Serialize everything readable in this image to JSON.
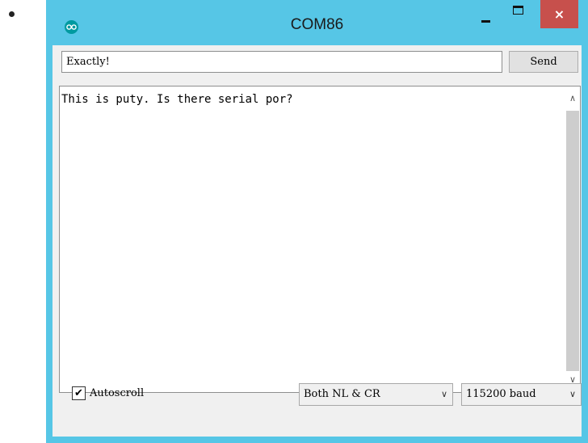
{
  "window": {
    "title": "COM86",
    "close_glyph": "×",
    "icons": {
      "app": "arduino-logo-icon",
      "minimize": "minimize-icon",
      "maximize": "maximize-icon",
      "close": "close-icon"
    }
  },
  "send_bar": {
    "input_value": "Exactly!",
    "send_label": "Send"
  },
  "output": {
    "text": "This is puty. Is there serial por?"
  },
  "scrollbar": {
    "up_glyph": "∧",
    "down_glyph": "∨"
  },
  "footer": {
    "autoscroll_label": "Autoscroll",
    "autoscroll_checked": true,
    "check_glyph": "✔",
    "line_ending": "Both NL & CR",
    "baud_rate": "115200 baud",
    "chevron_glyph": "∨"
  },
  "colors": {
    "title_bar": "#56c6e6",
    "close_button": "#c7504c",
    "client_bg": "#f0f0f0"
  }
}
